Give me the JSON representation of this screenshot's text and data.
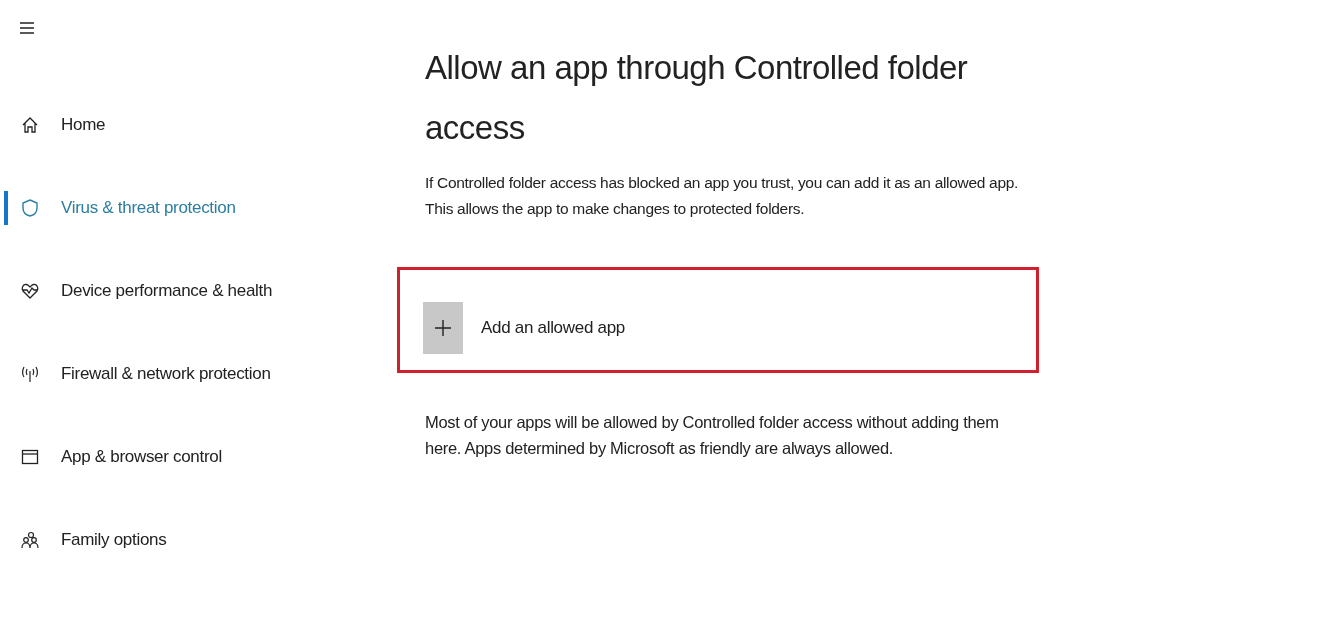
{
  "sidebar": {
    "items": [
      {
        "kind": "home",
        "label": "Home",
        "selected": false
      },
      {
        "kind": "shield",
        "label": "Virus & threat protection",
        "selected": true
      },
      {
        "kind": "heart",
        "label": "Device performance & health",
        "selected": false
      },
      {
        "kind": "antenna",
        "label": "Firewall & network protection",
        "selected": false
      },
      {
        "kind": "window",
        "label": "App & browser control",
        "selected": false
      },
      {
        "kind": "family",
        "label": "Family options",
        "selected": false
      }
    ]
  },
  "page": {
    "title": "Allow an app through Controlled folder access",
    "description": "If Controlled folder access has blocked an app you trust, you can add it as an allowed app. This allows the app to make changes to protected folders.",
    "add_button": {
      "label": "Add an allowed app",
      "highlighted": true
    },
    "note": "Most of your apps will be allowed by Controlled folder access without adding them here. Apps determined by Microsoft as friendly are always allowed."
  }
}
